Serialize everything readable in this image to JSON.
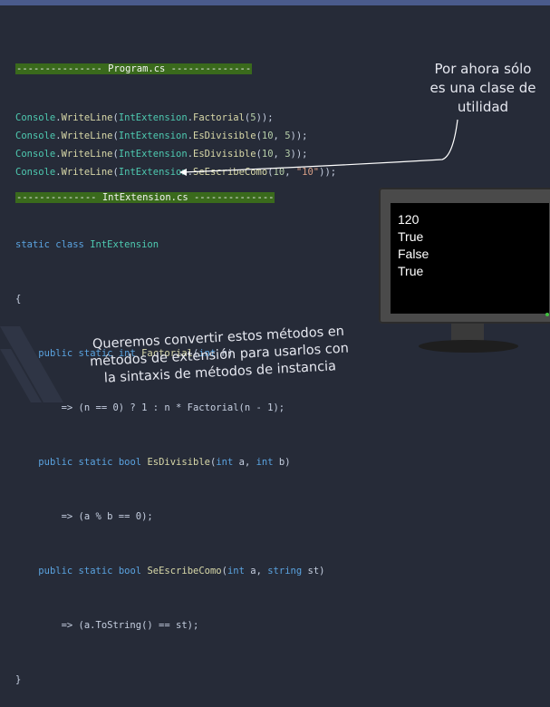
{
  "program": {
    "header": "--------------- Program.cs --------------",
    "lines": [
      {
        "obj": "Console",
        "method": "WriteLine",
        "cls": "IntExtension",
        "fn": "Factorial",
        "args_open": "(",
        "a1": "5",
        "sep": "",
        "a2": "",
        "close": "));"
      },
      {
        "obj": "Console",
        "method": "WriteLine",
        "cls": "IntExtension",
        "fn": "EsDivisible",
        "args_open": "(",
        "a1": "10",
        "sep": ", ",
        "a2": "5",
        "close": "));"
      },
      {
        "obj": "Console",
        "method": "WriteLine",
        "cls": "IntExtension",
        "fn": "EsDivisible",
        "args_open": "(",
        "a1": "10",
        "sep": ", ",
        "a2": "3",
        "close": "));"
      },
      {
        "obj": "Console",
        "method": "WriteLine",
        "cls": "IntExtension",
        "fn": "SeEscribeComo",
        "args_open": "(",
        "a1": "10",
        "sep": ", ",
        "a2": "\"10\"",
        "close": "));"
      }
    ]
  },
  "ext": {
    "header": "-------------- IntExtension.cs --------------",
    "l1_kw1": "static",
    "l1_kw2": "class",
    "l1_cls": "IntExtension",
    "brace_open": "{",
    "brace_close": "}",
    "m1": {
      "kw": "public static",
      "ret": "int",
      "name": "Factorial",
      "p1t": "int",
      "p1n": "n",
      "body": "=> (n == 0) ? 1 : n * Factorial(n - 1);"
    },
    "m2": {
      "kw": "public static",
      "ret": "bool",
      "name": "EsDivisible",
      "p1t": "int",
      "p1n": "a",
      "p2t": "int",
      "p2n": "b",
      "body": "=> (a % b == 0);"
    },
    "m3": {
      "kw": "public static",
      "ret": "bool",
      "name": "SeEscribeComo",
      "p1t": "int",
      "p1n": "a",
      "p2t": "string",
      "p2n": "st",
      "body": "=> (a.ToString() == st);"
    }
  },
  "callout": [
    "Por ahora sólo",
    "es una clase de",
    "utilidad"
  ],
  "bottom_text": [
    "Queremos convertir estos métodos en",
    "métodos de extensión para usarlos con",
    "la sintaxis de métodos de instancia"
  ],
  "console_output": [
    "120",
    "True",
    "False",
    "True"
  ]
}
